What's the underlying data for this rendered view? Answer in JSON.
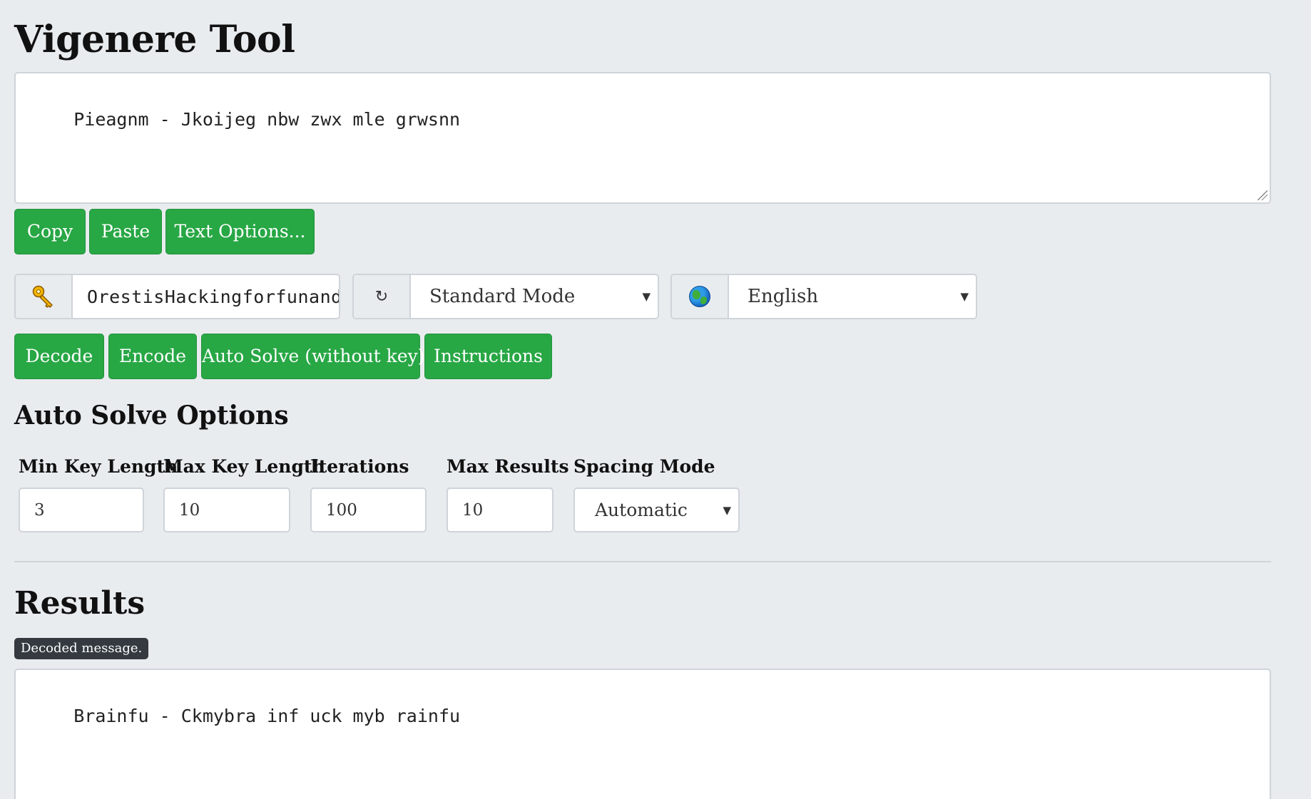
{
  "header": {
    "title": "Vigenere Tool"
  },
  "input": {
    "text": "Pieagnm - Jkoijeg nbw zwx mle grwsnn"
  },
  "text_buttons": {
    "copy": "Copy",
    "paste": "Paste",
    "text_options": "Text Options..."
  },
  "key": {
    "icon": "key-icon",
    "value": "OrestisHackingforfunand"
  },
  "mode": {
    "icon": "refresh-icon",
    "glyph": "↻",
    "value": "Standard Mode"
  },
  "language": {
    "icon": "globe-icon",
    "value": "English"
  },
  "action_buttons": {
    "decode": "Decode",
    "encode": "Encode",
    "auto_solve": "Auto Solve (without key)",
    "instructions": "Instructions"
  },
  "auto_solve": {
    "title": "Auto Solve Options",
    "min_key_length": {
      "label": "Min Key Length",
      "value": "3"
    },
    "max_key_length": {
      "label": "Max Key Length",
      "value": "10"
    },
    "iterations": {
      "label": "Iterations",
      "value": "100"
    },
    "max_results": {
      "label": "Max Results",
      "value": "10"
    },
    "spacing_mode": {
      "label": "Spacing Mode",
      "value": "Automatic"
    }
  },
  "results": {
    "title": "Results",
    "badge": "Decoded message.",
    "text": "Brainfu - Ckmybra inf uck myb rainfu"
  }
}
